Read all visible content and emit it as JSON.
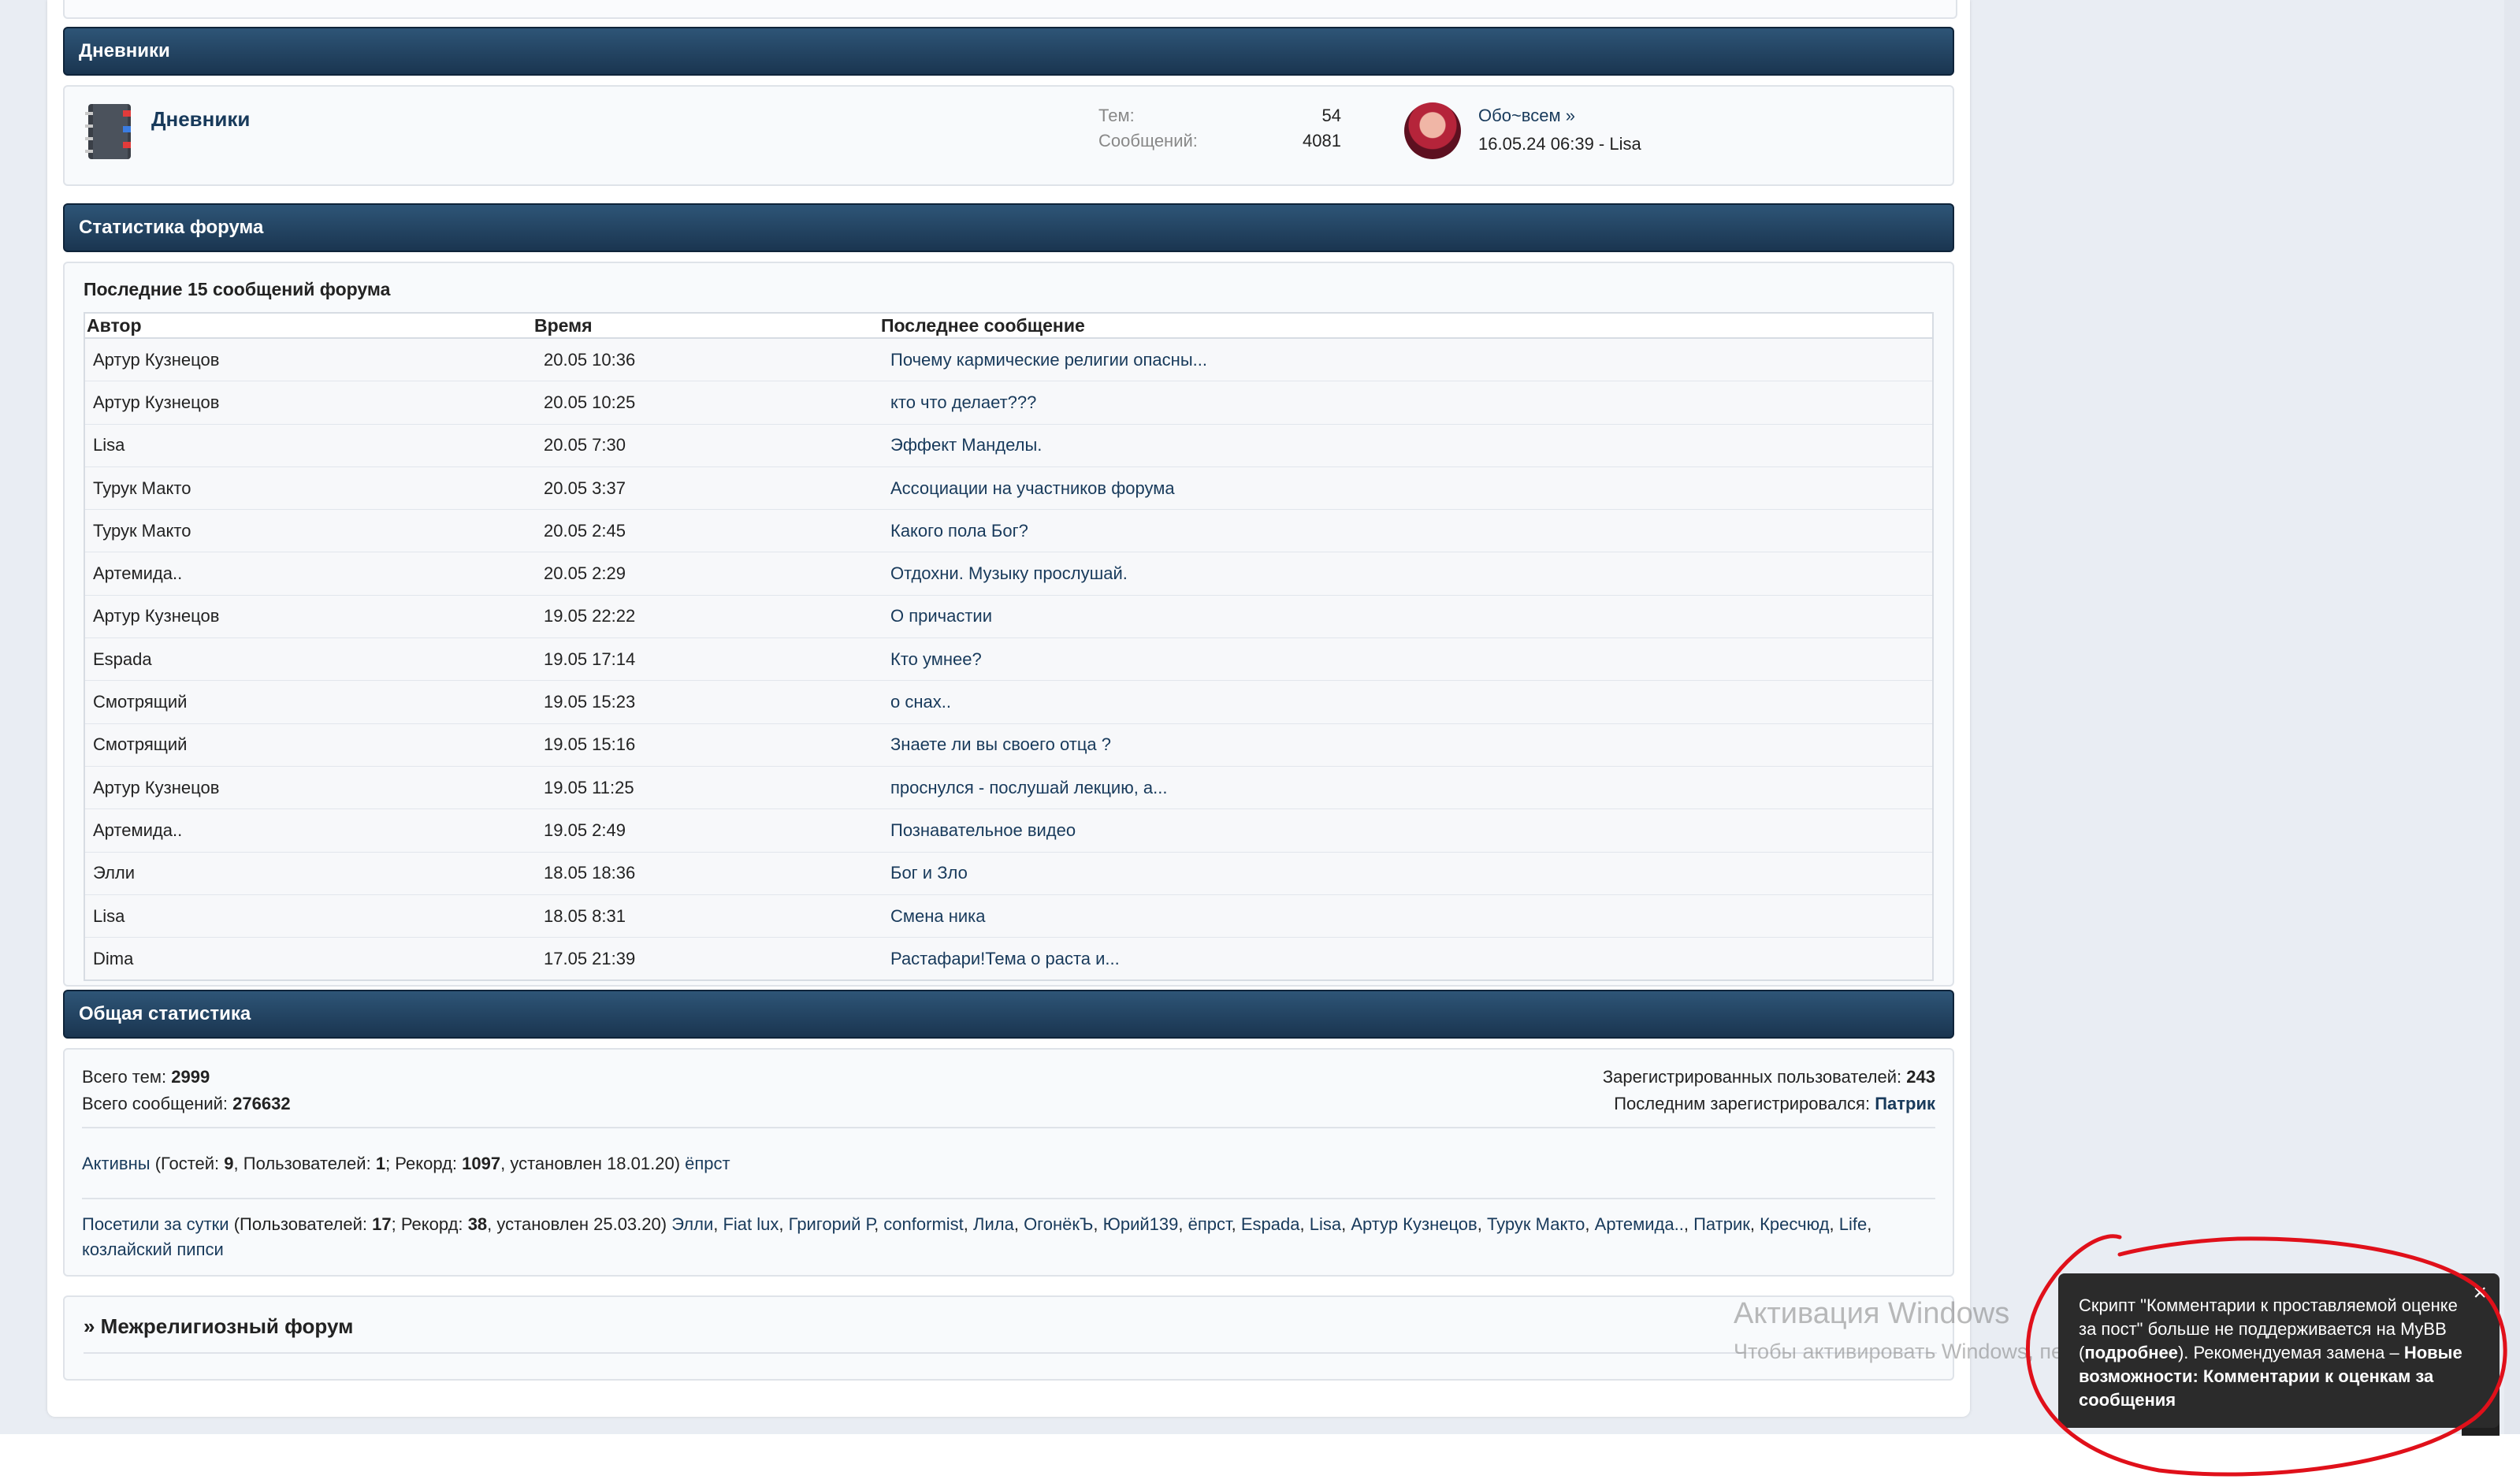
{
  "diaries_section": {
    "header": "Дневники",
    "forum": {
      "title": "Дневники",
      "topics_label": "Тем:",
      "topics_value": "54",
      "posts_label": "Сообщений:",
      "posts_value": "4081",
      "last_post_link": "Обо~всем »",
      "last_post_meta": "16.05.24 06:39 - Lisa"
    }
  },
  "forum_stats_section": {
    "header": "Статистика форума",
    "latest_title": "Последние 15 сообщений форума",
    "columns": [
      "Автор",
      "Время",
      "Последнее сообщение"
    ],
    "rows": [
      [
        "Артур Кузнецов",
        "20.05 10:36",
        "Почему кармические религии опасны..."
      ],
      [
        "Артур Кузнецов",
        "20.05 10:25",
        "кто что делает???"
      ],
      [
        "Lisa",
        "20.05 7:30",
        "Эффект Манделы."
      ],
      [
        "Турук Макто",
        "20.05 3:37",
        "Ассоциации на участников форума"
      ],
      [
        "Турук Макто",
        "20.05 2:45",
        "Какого пола Бог?"
      ],
      [
        "Артемида..",
        "20.05 2:29",
        "Отдохни. Музыку прослушай."
      ],
      [
        "Артур Кузнецов",
        "19.05 22:22",
        "О причастии"
      ],
      [
        "Espada",
        "19.05 17:14",
        "Кто умнее?"
      ],
      [
        "Смотрящий",
        "19.05 15:23",
        "о снах.."
      ],
      [
        "Смотрящий",
        "19.05 15:16",
        "Знаете ли вы своего отца ?"
      ],
      [
        "Артур Кузнецов",
        "19.05 11:25",
        "проснулся - послушай лекцию, а..."
      ],
      [
        "Артемида..",
        "19.05 2:49",
        "Познавательное видео"
      ],
      [
        "Элли",
        "18.05 18:36",
        "Бог и Зло"
      ],
      [
        "Lisa",
        "18.05 8:31",
        "Смена ника"
      ],
      [
        "Dima",
        "17.05 21:39",
        "Растафари!Тема о раста и..."
      ]
    ]
  },
  "general_stats": {
    "header": "Общая статистика",
    "total_topics_label": "Всего тем:",
    "total_topics_value": "2999",
    "total_posts_label": "Всего сообщений:",
    "total_posts_value": "276632",
    "registered_label": "Зарегистрированных пользователей:",
    "registered_value": "243",
    "last_registered_label": "Последним зарегистрировался:",
    "last_registered_value": "Патрик",
    "active_label": "Активны",
    "active_guests_label": "(Гостей:",
    "active_guests_value": "9",
    "active_users_label": ", Пользователей:",
    "active_users_value": "1",
    "active_record_label": "; Рекорд:",
    "active_record_value": "1097",
    "active_record_date": ", установлен 18.01.20)",
    "active_user": "ёпрст",
    "visited_label": "Посетили за сутки",
    "visited_users_label": "(Пользователей:",
    "visited_users_value": "17",
    "visited_record_label": "; Рекорд:",
    "visited_record_value": "38",
    "visited_record_date": ", установлен 25.03.20)",
    "visited_users": [
      "Элли",
      "Fiat lux",
      "Григорий Р",
      "conformist",
      "Лила",
      "ОгонёкЪ",
      "Юрий139",
      "ёпрст",
      "Espada",
      "Lisa",
      "Артур Кузнецов",
      "Турук Макто",
      "Артемида..",
      "Патрик",
      "Кресчюд",
      "Life",
      "козлайский пипси"
    ]
  },
  "interreligious": {
    "title": "» Межрелигиозный форум"
  },
  "watermark": {
    "line1": "Активация Windows",
    "line2": "Чтобы активировать Windows, перейдите в раздел"
  },
  "toast": {
    "close": "×",
    "text_part1": "Скрипт \"Комментарии к проставляемой оценке за пост\" больше не поддерживается на MyBB (",
    "text_link": "подробнее",
    "text_part2": "). Рекомендуемая замена – ",
    "text_bold": "Новые возможности: Комментарии к оценкам за сообщения"
  },
  "colors": {
    "header_gradient_top": "#2e5577",
    "header_gradient_bottom": "#1a3550",
    "link": "#183a5b",
    "annotation_red": "#e0101a"
  }
}
